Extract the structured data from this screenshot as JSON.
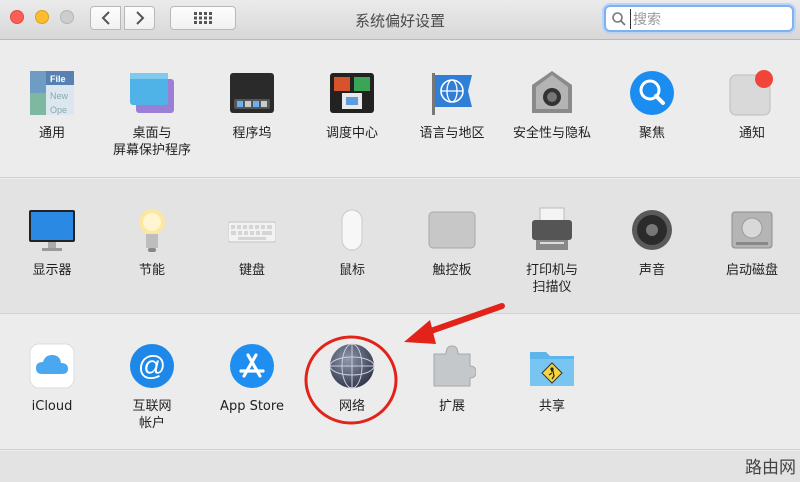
{
  "window": {
    "title": "系统偏好设置"
  },
  "search": {
    "placeholder": "搜索"
  },
  "rows": [
    [
      {
        "label": "通用",
        "icon": "general-icon"
      },
      {
        "label": "桌面与\n屏幕保护程序",
        "icon": "desktop-screensaver-icon"
      },
      {
        "label": "程序坞",
        "icon": "dock-icon"
      },
      {
        "label": "调度中心",
        "icon": "mission-control-icon"
      },
      {
        "label": "语言与地区",
        "icon": "language-region-icon"
      },
      {
        "label": "安全性与隐私",
        "icon": "security-privacy-icon"
      },
      {
        "label": "聚焦",
        "icon": "spotlight-icon"
      },
      {
        "label": "通知",
        "icon": "notifications-icon"
      }
    ],
    [
      {
        "label": "显示器",
        "icon": "displays-icon"
      },
      {
        "label": "节能",
        "icon": "energy-saver-icon"
      },
      {
        "label": "键盘",
        "icon": "keyboard-icon"
      },
      {
        "label": "鼠标",
        "icon": "mouse-icon"
      },
      {
        "label": "触控板",
        "icon": "trackpad-icon"
      },
      {
        "label": "打印机与\n扫描仪",
        "icon": "printers-scanners-icon"
      },
      {
        "label": "声音",
        "icon": "sound-icon"
      },
      {
        "label": "启动磁盘",
        "icon": "startup-disk-icon"
      }
    ],
    [
      {
        "label": "iCloud",
        "icon": "icloud-icon"
      },
      {
        "label": "互联网\n帐户",
        "icon": "internet-accounts-icon"
      },
      {
        "label": "App Store",
        "icon": "app-store-icon"
      },
      {
        "label": "网络",
        "icon": "network-icon"
      },
      {
        "label": "扩展",
        "icon": "extensions-icon"
      },
      {
        "label": "共享",
        "icon": "sharing-icon"
      }
    ]
  ],
  "general_icon_text": {
    "line1": "File",
    "line2": "New",
    "line3": "Ope"
  },
  "watermark": "路由网",
  "annotation_color": "#e2231a"
}
